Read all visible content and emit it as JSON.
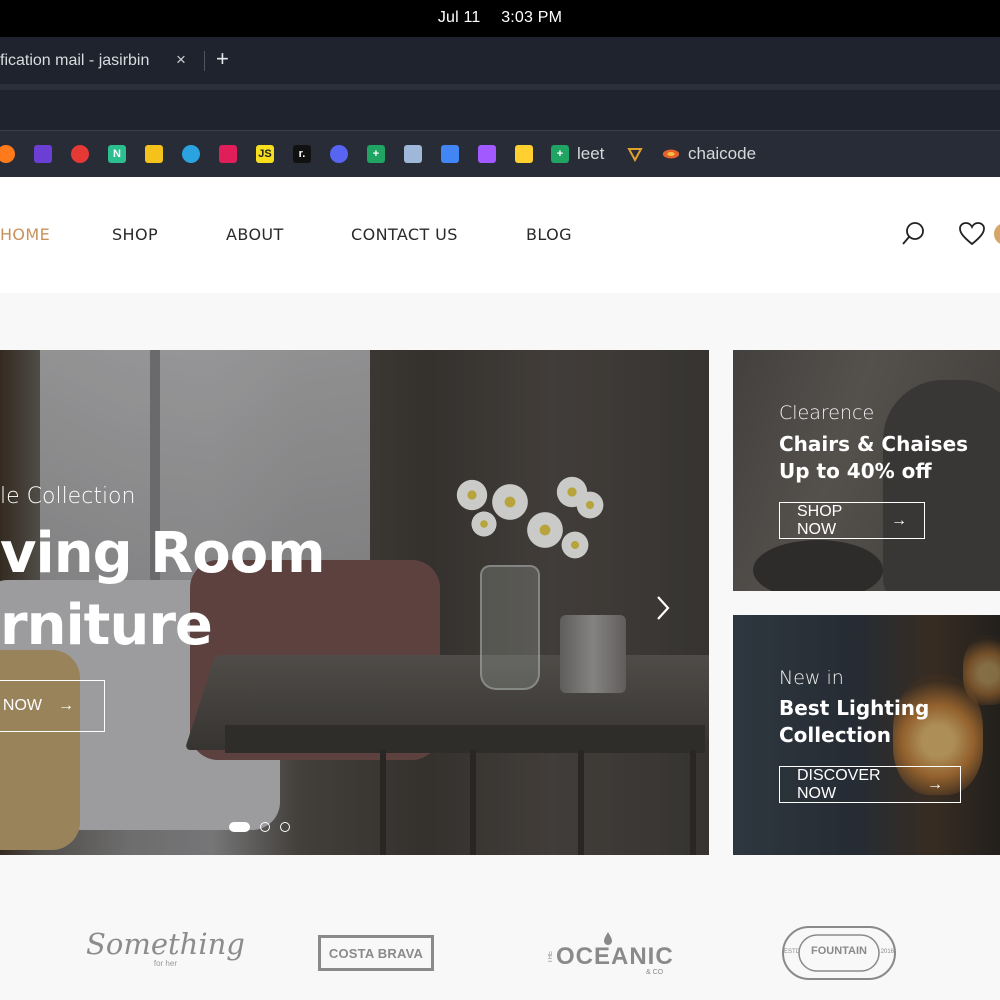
{
  "os": {
    "date": "Jul 11",
    "time": "3:03 PM"
  },
  "browser": {
    "tab_title": "fication mail - jasirbin",
    "tab_close": "×",
    "new_tab": "+",
    "bookmarks": [
      {
        "icon": "firefox-icon",
        "color": "#ff7a1a"
      },
      {
        "icon": "bolt-icon",
        "color": "#6b3fd4"
      },
      {
        "icon": "youtube-icon",
        "color": "#e53935"
      },
      {
        "icon": "notion-icon",
        "color": "#2bbf8f",
        "glyph": "N"
      },
      {
        "icon": "keep-icon",
        "color": "#f5c21b"
      },
      {
        "icon": "telegram-icon",
        "color": "#2aa3e0"
      },
      {
        "icon": "slack-icon",
        "color": "#e01e5a"
      },
      {
        "icon": "js-icon",
        "color": "#f7df1e",
        "glyph": "JS"
      },
      {
        "icon": "replit-icon",
        "color": "#111111",
        "glyph": "r."
      },
      {
        "icon": "discord-icon",
        "color": "#5865f2"
      },
      {
        "icon": "sheets-icon",
        "color": "#1fa463",
        "glyph": "+"
      },
      {
        "icon": "book-icon",
        "color": "#9fb7d9"
      },
      {
        "icon": "docs-icon",
        "color": "#4285f4"
      },
      {
        "icon": "figma-icon",
        "color": "#a259ff"
      },
      {
        "icon": "miro-icon",
        "color": "#ffd02f"
      }
    ],
    "bookmark_leet_label": "leet",
    "bookmark_chaicode_label": "chaicode"
  },
  "nav": {
    "home": "HOME",
    "shop": "SHOP",
    "about": "ABOUT",
    "contact": "CONTACT US",
    "blog": "BLOG",
    "accent_color": "#c9925a"
  },
  "hero": {
    "subtitle": "le Collection",
    "title_line1": "ving Room",
    "title_line2": "rniture",
    "button": "P NOW",
    "button_arrow": "→",
    "next_arrow": "›",
    "slides": 3,
    "active_slide": 1
  },
  "promo1": {
    "kicker": "Clearence",
    "headline_line1": "Chairs & Chaises",
    "headline_line2": "Up to 40% off",
    "button": "SHOP NOW",
    "arrow": "→"
  },
  "promo2": {
    "kicker": "New in",
    "headline_line1": "Best Lighting",
    "headline_line2": "Collection",
    "button": "DISCOVER NOW",
    "arrow": "→"
  },
  "brands": {
    "something": "Something",
    "something_sub": "for her",
    "costa": "COSTA BRAVA",
    "oceanic_the": "THE",
    "oceanic": "OCEANIC",
    "oceanic_co": "& CO",
    "fountain": "FOUNTAIN",
    "fountain_left": "ESTD",
    "fountain_right": "2016"
  }
}
